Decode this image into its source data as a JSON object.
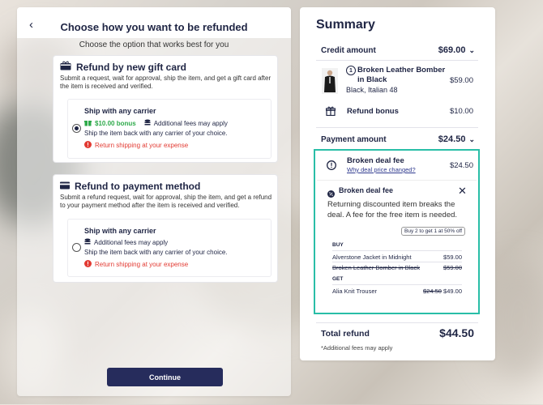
{
  "left": {
    "title": "Choose how you want to be refunded",
    "subtitle": "Choose the option that works best for you",
    "option1": {
      "heading": "Refund by new gift card",
      "desc": "Submit a request, wait for approval, ship the item, and get a gift card after the item is received and verified.",
      "sub_title": "Ship with any carrier",
      "bonus": "$10.00 bonus",
      "fees": "Additional fees may apply",
      "ship_note": "Ship the item back with any carrier of your choice.",
      "warning": "Return shipping at your expense",
      "selected": true
    },
    "option2": {
      "heading": "Refund to payment method",
      "desc": "Submit a refund request, wait for approval, ship the item, and get a refund to your payment method after the item is received and verified.",
      "sub_title": "Ship with any carrier",
      "fees": "Additional fees may apply",
      "ship_note": "Ship the item back with any carrier of your choice.",
      "warning": "Return shipping at your expense",
      "selected": false
    },
    "continue_label": "Continue"
  },
  "summary": {
    "title": "Summary",
    "credit_label": "Credit amount",
    "credit_value": "$69.00",
    "item_qty": "1",
    "item_name": "Broken Leather Bomber in Black",
    "item_variant": "Black, Italian 48",
    "item_price": "$59.00",
    "refund_bonus_label": "Refund bonus",
    "refund_bonus_value": "$10.00",
    "payment_label": "Payment amount",
    "payment_value": "$24.50",
    "deal_fee_label": "Broken deal fee",
    "deal_fee_link": "Why deal price changed?",
    "deal_fee_value": "$24.50",
    "popup": {
      "title": "Broken deal fee",
      "text": "Returning discounted item breaks the deal. A fee for the free item is needed.",
      "promo": "Buy 2 to get 1 at 50% off",
      "buy_label": "BUY",
      "buy_items": [
        {
          "name": "Alverstone Jacket in Midnight",
          "price": "$59.00"
        },
        {
          "name": "Broken Leather Bomber in Black",
          "price": "$59.00"
        }
      ],
      "get_label": "GET",
      "get_item": {
        "name": "Alia Knit Trouser",
        "old_price": "$24.50",
        "price": "$49.00"
      }
    },
    "total_label": "Total refund",
    "total_value": "$44.50",
    "footnote": "*Additional fees may apply"
  },
  "colors": {
    "accent": "#262c5c",
    "teal": "#29bea7",
    "green": "#2eaa4a",
    "red": "#e23a32"
  }
}
